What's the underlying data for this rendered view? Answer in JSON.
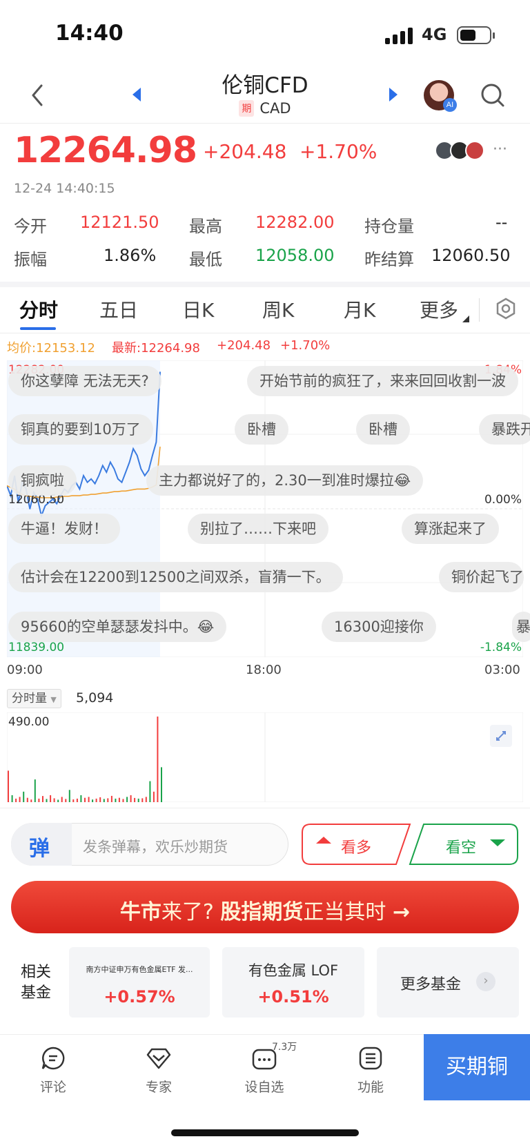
{
  "status_bar": {
    "time": "14:40",
    "network": "4G"
  },
  "header": {
    "title": "伦铜CFD",
    "tag": "期",
    "subtitle": "CAD"
  },
  "quote": {
    "price": "12264.98",
    "change": "+204.48",
    "change_pct": "+1.70%",
    "timestamp": "12-24 14:40:15",
    "stats": {
      "open_label": "今开",
      "open": "12121.50",
      "high_label": "最高",
      "high": "12282.00",
      "oi_label": "持仓量",
      "oi": "--",
      "amp_label": "振幅",
      "amp": "1.86%",
      "low_label": "最低",
      "low": "12058.00",
      "prev_label": "昨结算",
      "prev": "12060.50"
    }
  },
  "tabs": [
    "分时",
    "五日",
    "日K",
    "周K",
    "月K",
    "更多"
  ],
  "chart_info": {
    "avg": "均价:12153.12",
    "last": "最新:12264.98",
    "chg": "+204.48",
    "pct": "+1.70%"
  },
  "chart_data": {
    "type": "line",
    "title": "",
    "ylim": [
      11839.0,
      12282.0
    ],
    "y_ticks": {
      "top": "12282.00",
      "mid": "12060.50",
      "bottom": "11839.00"
    },
    "pct_ticks": {
      "top": "1.84%",
      "mid": "0.00%",
      "bottom": "-1.84%"
    },
    "x_ticks": [
      "09:00",
      "18:00",
      "03:00"
    ],
    "series": [
      {
        "name": "",
        "color": "#3a7be0",
        "values": [
          12095,
          12080,
          12110,
          12070,
          12100,
          12090,
          12060,
          12085,
          12075,
          12050,
          12065,
          12070,
          12075,
          12068,
          12080,
          12090,
          12085,
          12095,
          12100,
          12090,
          12110,
          12100,
          12105,
          12098,
          12110,
          12125,
          12115,
          12130,
          12120,
          12105,
          12100,
          12115,
          12130,
          12150,
          12140,
          12120,
          12110,
          12118,
          12140,
          12160,
          12264.98
        ]
      },
      {
        "name": "",
        "color": "#f0a030",
        "values": [
          12095,
          12092,
          12090,
          12085,
          12082,
          12080,
          12079,
          12078,
          12078,
          12077,
          12077,
          12077,
          12077,
          12078,
          12078,
          12079,
          12079,
          12080,
          12080,
          12080,
          12081,
          12081,
          12082,
          12082,
          12083,
          12084,
          12084,
          12085,
          12086,
          12086,
          12087,
          12087,
          12088,
          12089,
          12090,
          12090,
          12090,
          12091,
          12093,
          12096,
          12153.12
        ]
      }
    ],
    "volume": {
      "label": "分时量",
      "total": "5,094",
      "max": "490.00",
      "bars": [
        180,
        40,
        20,
        30,
        60,
        25,
        15,
        130,
        20,
        35,
        18,
        40,
        22,
        14,
        30,
        18,
        70,
        16,
        20,
        40,
        25,
        30,
        15,
        20,
        28,
        18,
        22,
        36,
        20,
        25,
        18,
        30,
        40,
        24,
        20,
        22,
        30,
        120,
        60,
        490,
        200
      ]
    }
  },
  "comments": [
    "你这孽障  无法无天?",
    "开始节前的疯狂了，来来回回收割一波",
    "铜真的要到10万了",
    "卧槽",
    "卧槽",
    "暴跌开",
    "铜疯啦",
    "主力都说好了的，2.30一到准时爆拉😂",
    "牛逼！发财！",
    "别拉了……下来吧",
    "算涨起来了",
    "估计会在12200到12500之间双杀，盲猜一下。",
    "铜价起飞了",
    "95660的空单瑟瑟发抖中。😂",
    "16300迎接你",
    "暴"
  ],
  "input": {
    "placeholder": "发条弹幕，欢乐炒期货",
    "icon": "弹"
  },
  "actions": {
    "bull": "看多",
    "bear": "看空"
  },
  "banner": {
    "part1": "牛市",
    "part2": "来了?",
    "part3": "股指期货",
    "part4": "正当其时",
    "arrow": "→"
  },
  "funds": {
    "label": "相关基金",
    "items": [
      {
        "name": "南方中证申万有色金属ETF 发...",
        "value": "+0.57%"
      },
      {
        "name": "有色金属 LOF",
        "value": "+0.51%"
      }
    ],
    "more": "更多基金"
  },
  "bottom_bar": {
    "items": [
      {
        "label": "评论"
      },
      {
        "label": "专家"
      },
      {
        "label": "设自选",
        "badge": "7.3万"
      },
      {
        "label": "功能"
      }
    ],
    "buy": "买期铜"
  },
  "colors": {
    "up": "#f23d3d",
    "down": "#1aa34a",
    "accent": "#2a6ee8"
  }
}
